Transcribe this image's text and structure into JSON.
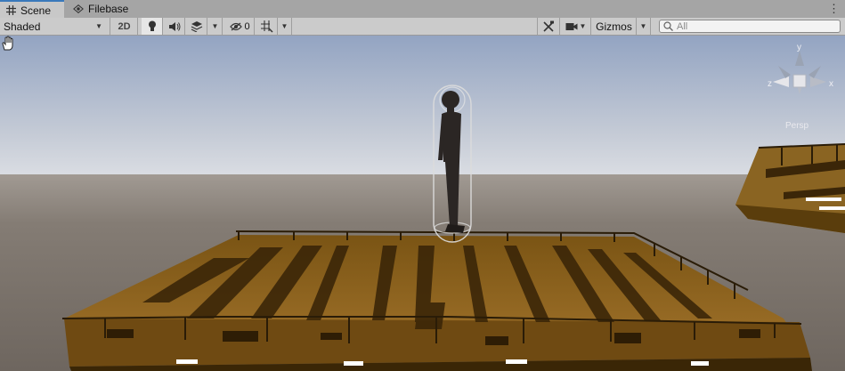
{
  "tabs": [
    {
      "label": "Scene",
      "icon": "grid-icon",
      "active": true
    },
    {
      "label": "Filebase",
      "icon": "eye-icon",
      "active": false
    }
  ],
  "toolbar": {
    "draw_mode": "Shaded",
    "mode_2d_label": "2D",
    "hidden_count": "0",
    "gizmos_label": "Gizmos",
    "search_placeholder": "All"
  },
  "gizmo": {
    "y_label": "y",
    "x_label": "x",
    "z_label": "z",
    "projection_label": "Persp"
  },
  "colors": {
    "accent": "#3a79bb",
    "sky_top": "#97a8c5",
    "horizon": "#d6dbe3",
    "ground": "#7a726b",
    "wood": "#8f6520"
  }
}
